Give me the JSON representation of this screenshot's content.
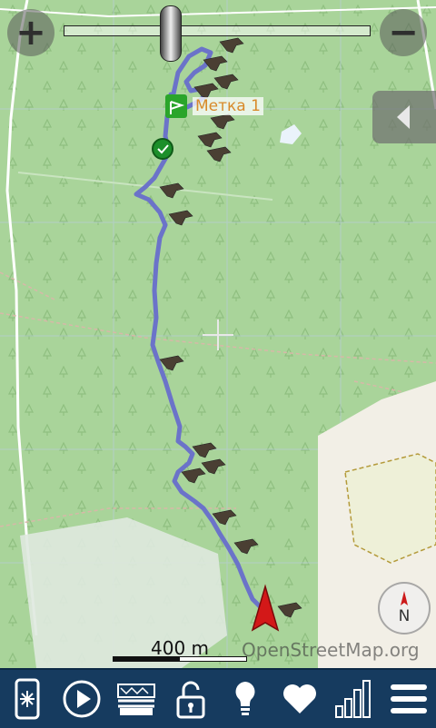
{
  "map": {
    "marker_label": "Метка 1",
    "scale_label": "400 m",
    "attribution": "OpenStreetMap.org",
    "compass_label": "N",
    "colors": {
      "forest": "#a9d49a",
      "track": "#6b73c9",
      "start_green": "#1c8f2a",
      "arrow_red": "#d31818"
    }
  },
  "controls": {
    "zoom_in_icon": "plus-icon",
    "zoom_out_icon": "minus-icon",
    "panel_toggle_icon": "chevron-left-icon"
  },
  "toolbar": {
    "items": [
      {
        "icon": "phone-snowflake-icon"
      },
      {
        "icon": "play-icon"
      },
      {
        "icon": "map-layers-icon"
      },
      {
        "icon": "unlock-icon"
      },
      {
        "icon": "lightbulb-icon"
      },
      {
        "icon": "heart-icon"
      },
      {
        "icon": "signal-bars-icon"
      },
      {
        "icon": "menu-icon"
      }
    ],
    "background": "#163b5f"
  }
}
